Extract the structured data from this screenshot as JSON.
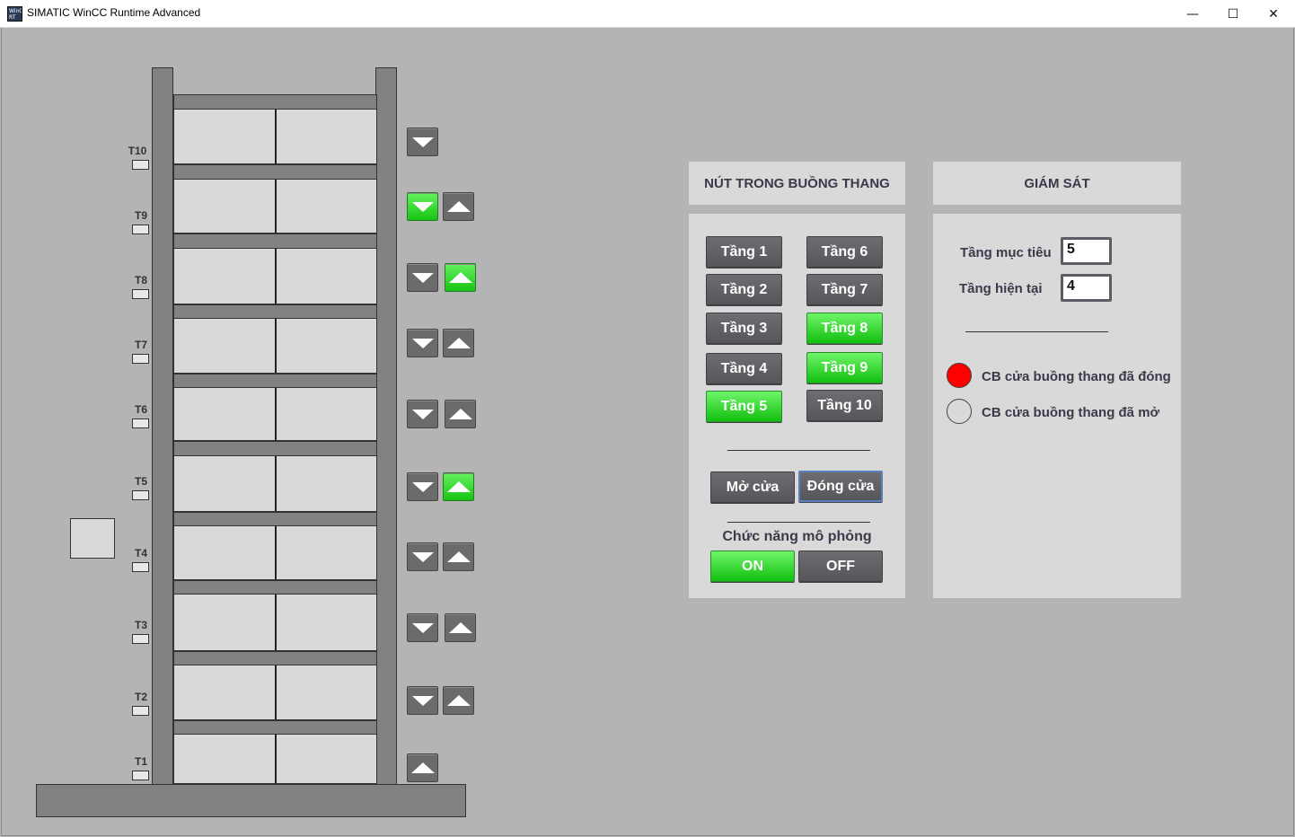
{
  "window": {
    "title": "SIMATIC WinCC Runtime Advanced",
    "icon_text": "WinCC RT",
    "minimize": "—",
    "maximize": "☐",
    "close": "✕"
  },
  "shaft": {
    "floors": [
      "T10",
      "T9",
      "T8",
      "T7",
      "T6",
      "T5",
      "T4",
      "T3",
      "T2",
      "T1"
    ]
  },
  "call_buttons": [
    {
      "floor": "T10",
      "down": "off",
      "up": null
    },
    {
      "floor": "T9",
      "down": "on",
      "up": "off"
    },
    {
      "floor": "T8",
      "down": "off",
      "up": "on"
    },
    {
      "floor": "T7",
      "down": "off",
      "up": "off"
    },
    {
      "floor": "T6",
      "down": "off",
      "up": "off"
    },
    {
      "floor": "T5",
      "down": "off",
      "up": "on"
    },
    {
      "floor": "T4",
      "down": "off",
      "up": "off"
    },
    {
      "floor": "T3",
      "down": "off",
      "up": "off"
    },
    {
      "floor": "T2",
      "down": "off",
      "up": "off"
    },
    {
      "floor": "T1",
      "down": null,
      "up": "off"
    }
  ],
  "cabin_panel": {
    "title": "NÚT TRONG BUỒNG THANG",
    "floor_buttons": [
      {
        "label": "Tầng 1",
        "state": "off"
      },
      {
        "label": "Tầng 2",
        "state": "off"
      },
      {
        "label": "Tầng 3",
        "state": "off"
      },
      {
        "label": "Tầng 4",
        "state": "off"
      },
      {
        "label": "Tầng 5",
        "state": "on"
      },
      {
        "label": "Tầng 6",
        "state": "off"
      },
      {
        "label": "Tầng 7",
        "state": "off"
      },
      {
        "label": "Tầng 8",
        "state": "on"
      },
      {
        "label": "Tầng 9",
        "state": "on"
      },
      {
        "label": "Tầng 10",
        "state": "off"
      }
    ],
    "open_door": "Mở cửa",
    "close_door": "Đóng cửa",
    "simulation_label": "Chức năng mô phỏng",
    "sim_on": "ON",
    "sim_off": "OFF",
    "sim_state": "on"
  },
  "monitor_panel": {
    "title": "GIÁM SÁT",
    "target_floor_label": "Tầng mục tiêu",
    "target_floor_value": "5",
    "current_floor_label": "Tầng hiện tại",
    "current_floor_value": "4",
    "door_closed_label": "CB cửa buồng thang đã đóng",
    "door_closed_state": "on",
    "door_open_label": "CB cửa buồng thang đã mở",
    "door_open_state": "off"
  },
  "colors": {
    "active_green": "#18c414",
    "button_gray": "#55555a",
    "lamp_red": "#ff0000",
    "background": "#b4b4b4",
    "panel": "#d9d9d9"
  }
}
